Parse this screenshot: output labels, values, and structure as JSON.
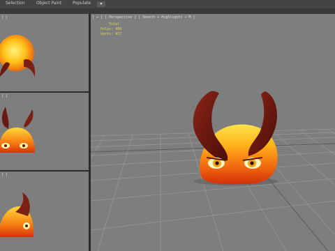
{
  "ribbon": {
    "tabs": [
      "Selection",
      "Object Paint",
      "Populate"
    ],
    "toggle_icon": "▾"
  },
  "viewports": {
    "top_label": "[ ]",
    "front_label": "[ ]",
    "left_label": "[ ]",
    "perspective_label": "[ + ] [ Perspective ] [ Smooth + Highlights + M ]"
  },
  "stats": {
    "total_label": "Total",
    "polys_label": "Polys: 400",
    "verts_label": "Verts: 417"
  },
  "colors": {
    "viewport_bg": "#7e7e7e",
    "slime_top": "#ffe24a",
    "slime_bottom": "#e23b0a",
    "horn": "#6b1a12"
  }
}
